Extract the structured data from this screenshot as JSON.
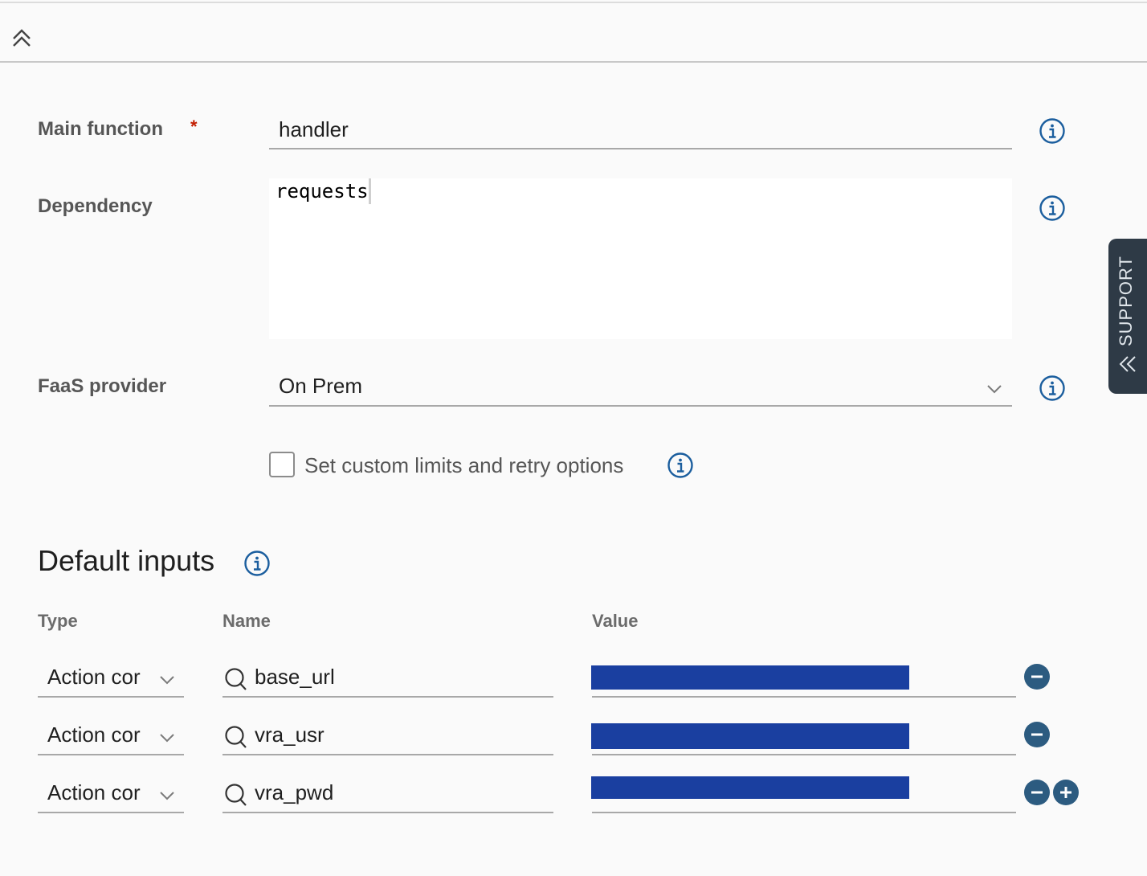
{
  "form": {
    "main_function": {
      "label": "Main function",
      "required_mark": "*",
      "value": "handler"
    },
    "dependency": {
      "label": "Dependency",
      "value": "requests"
    },
    "faas_provider": {
      "label": "FaaS provider",
      "selected": "On Prem"
    },
    "custom_limits": {
      "label": "Set custom limits and retry options",
      "checked": false
    }
  },
  "default_inputs": {
    "title": "Default inputs",
    "columns": {
      "type": "Type",
      "name": "Name",
      "value": "Value"
    },
    "rows": [
      {
        "type": "Action cor",
        "name": "base_url",
        "value_redacted": true
      },
      {
        "type": "Action cor",
        "name": "vra_usr",
        "value_redacted": true
      },
      {
        "type": "Action cor",
        "name": "vra_pwd",
        "value_redacted": true
      }
    ]
  },
  "support_tab": {
    "label": "SUPPORT"
  },
  "icons": {
    "collapse": "double-chevron-up-icon",
    "info": "info-circle-icon",
    "search": "search-icon",
    "dropdown": "chevron-down-icon",
    "remove": "minus-circle-icon",
    "add": "plus-circle-icon",
    "support_expand": "double-chevron-left-icon"
  },
  "colors": {
    "accent": "#1b5e9e",
    "action_button": "#2c5b80",
    "required": "#c21d00",
    "redaction": "#1a3fa0",
    "support_tab": "#2e3a46"
  }
}
